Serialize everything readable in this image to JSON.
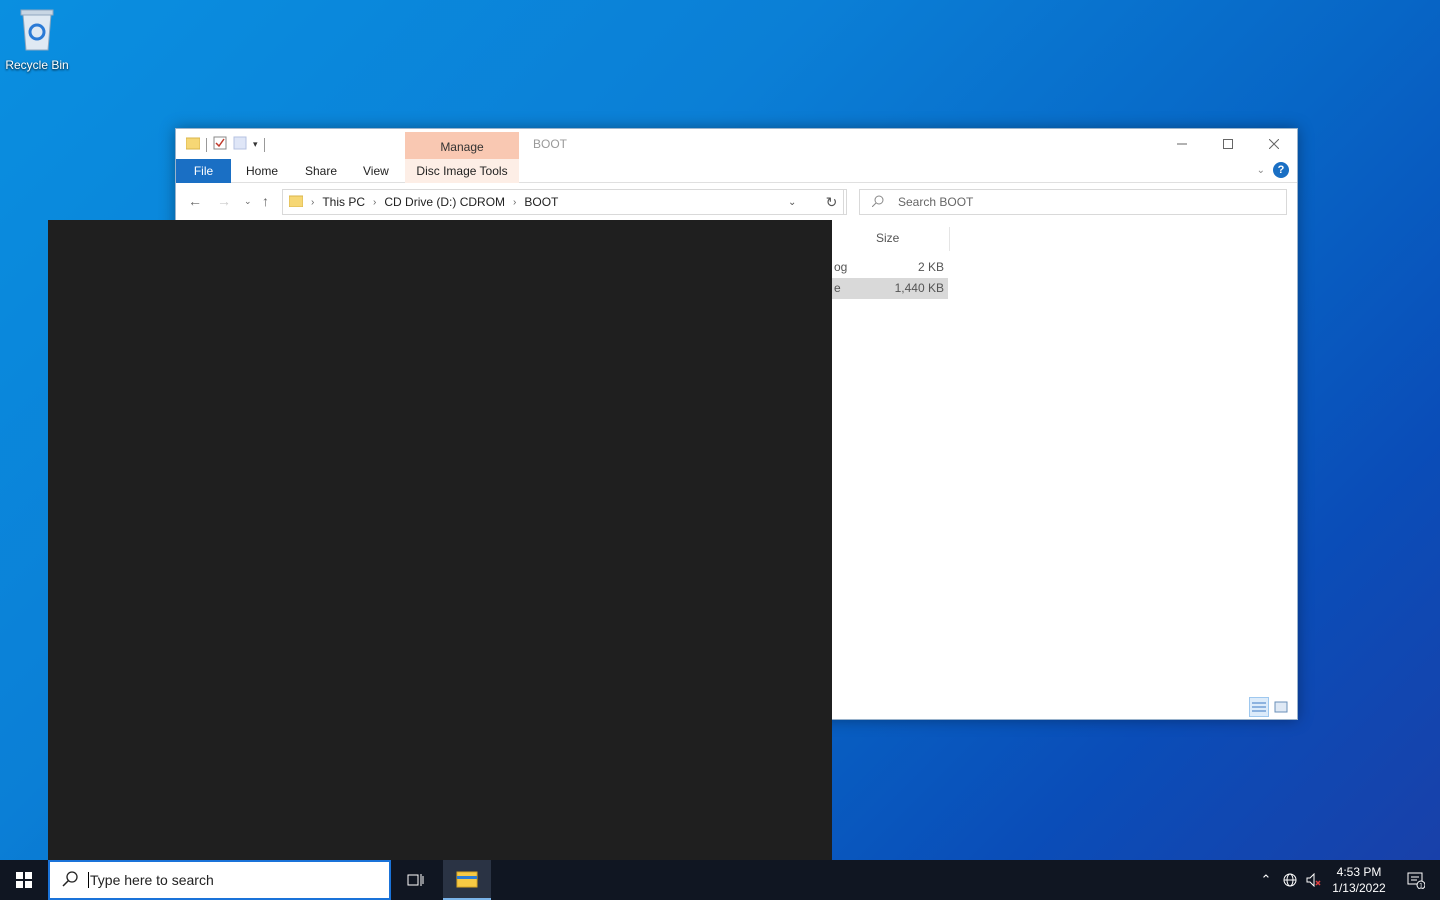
{
  "desktop": {
    "recycle_bin_label": "Recycle Bin"
  },
  "explorer": {
    "title": "BOOT",
    "manage_tab": "Manage",
    "ribbon_tabs": {
      "file": "File",
      "home": "Home",
      "share": "Share",
      "view": "View",
      "disc_image_tools": "Disc Image Tools"
    },
    "breadcrumb": [
      "This PC",
      "CD Drive (D:) CDROM",
      "BOOT"
    ],
    "search_placeholder": "Search BOOT",
    "column_size": "Size",
    "rows": [
      {
        "name_fragment": "og",
        "size": "2 KB",
        "selected": false
      },
      {
        "name_fragment": "e",
        "size": "1,440 KB",
        "selected": true
      }
    ]
  },
  "taskbar": {
    "search_placeholder": "Type here to search",
    "time": "4:53 PM",
    "date": "1/13/2022",
    "notification_count": "1"
  },
  "colors": {
    "accent": "#1a6fc4",
    "manage_tab": "#f9c8b2",
    "taskbar": "#101622"
  }
}
